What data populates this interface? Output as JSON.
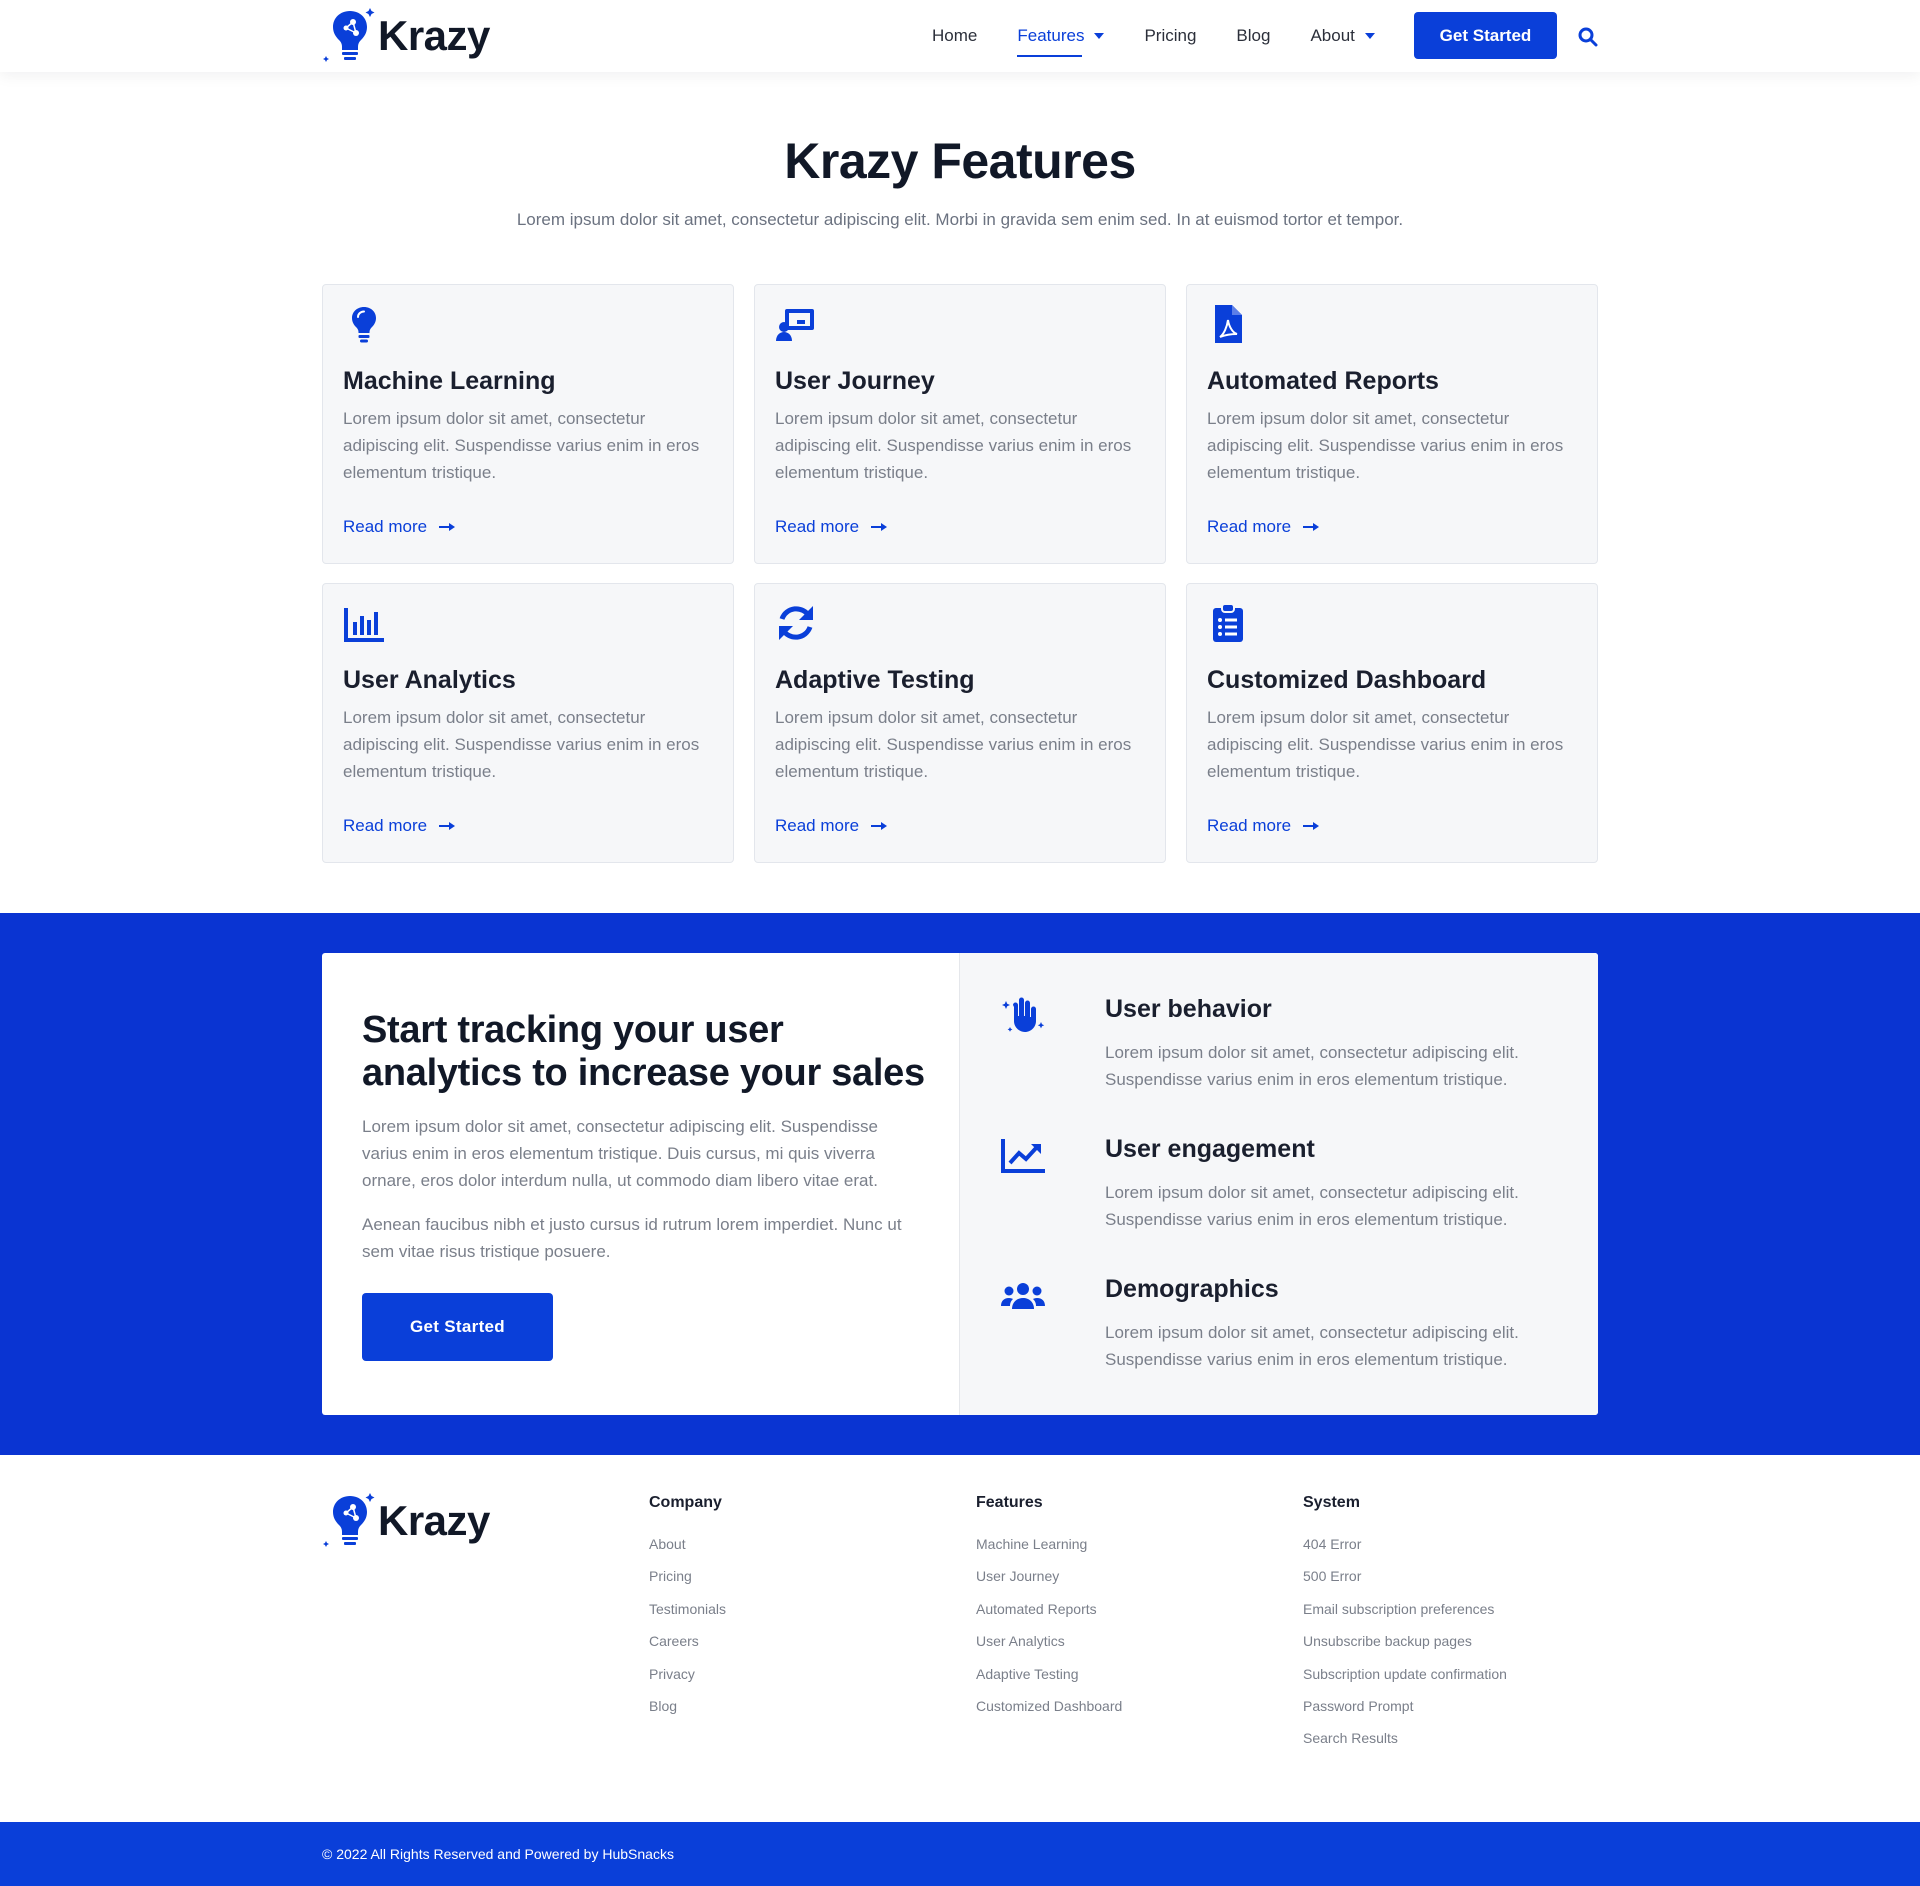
{
  "colors": {
    "brand": "#0a3fd9",
    "band": "#0a34d2",
    "card_bg": "#f6f7f9",
    "text_muted": "#7a7f8a"
  },
  "header": {
    "logo_text": "Krazy",
    "nav": [
      {
        "label": "Home"
      },
      {
        "label": "Features"
      },
      {
        "label": "Pricing"
      },
      {
        "label": "Blog"
      },
      {
        "label": "About"
      }
    ],
    "cta": "Get Started",
    "search_icon": "search-icon"
  },
  "hero": {
    "title": "Krazy Features",
    "subtitle": "Lorem ipsum dolor sit amet, consectetur adipiscing elit. Morbi in gravida sem enim sed. In at euismod tortor et tempor."
  },
  "features": [
    {
      "icon": "lightbulb-icon",
      "title": "Machine Learning",
      "text": "Lorem ipsum dolor sit amet, consectetur adipiscing elit. Suspendisse varius enim in eros elementum tristique.",
      "link": "Read more"
    },
    {
      "icon": "presentation-icon",
      "title": "User Journey",
      "text": "Lorem ipsum dolor sit amet, consectetur adipiscing elit. Suspendisse varius enim in eros elementum tristique.",
      "link": "Read more"
    },
    {
      "icon": "pdf-file-icon",
      "title": "Automated Reports",
      "text": "Lorem ipsum dolor sit amet, consectetur adipiscing elit. Suspendisse varius enim in eros elementum tristique.",
      "link": "Read more"
    },
    {
      "icon": "bar-chart-icon",
      "title": "User Analytics",
      "text": "Lorem ipsum dolor sit amet, consectetur adipiscing elit. Suspendisse varius enim in eros elementum tristique.",
      "link": "Read more"
    },
    {
      "icon": "sync-icon",
      "title": "Adaptive Testing",
      "text": "Lorem ipsum dolor sit amet, consectetur adipiscing elit. Suspendisse varius enim in eros elementum tristique.",
      "link": "Read more"
    },
    {
      "icon": "clipboard-list-icon",
      "title": "Customized Dashboard",
      "text": "Lorem ipsum dolor sit amet, consectetur adipiscing elit. Suspendisse varius enim in eros elementum tristique.",
      "link": "Read more"
    }
  ],
  "band": {
    "title": "Start tracking your user analytics to increase your sales",
    "p1": "Lorem ipsum dolor sit amet, consectetur adipiscing elit. Suspendisse varius enim in eros elementum tristique. Duis cursus, mi quis viverra ornare, eros dolor interdum nulla, ut commodo diam libero vitae erat.",
    "p2": "Aenean faucibus nibh et justo cursus id rutrum lorem imperdiet. Nunc ut sem vitae risus tristique posuere.",
    "cta": "Get Started",
    "benefits": [
      {
        "icon": "hand-sparkles-icon",
        "title": "User behavior",
        "text": "Lorem ipsum dolor sit amet, consectetur adipiscing elit. Suspendisse varius enim in eros elementum tristique."
      },
      {
        "icon": "trend-chart-icon",
        "title": "User engagement",
        "text": "Lorem ipsum dolor sit amet, consectetur adipiscing elit. Suspendisse varius enim in eros elementum tristique."
      },
      {
        "icon": "users-icon",
        "title": "Demographics",
        "text": "Lorem ipsum dolor sit amet, consectetur adipiscing elit. Suspendisse varius enim in eros elementum tristique."
      }
    ]
  },
  "footer": {
    "logo_text": "Krazy",
    "columns": [
      {
        "title": "Company",
        "links": [
          "About",
          "Pricing",
          "Testimonials",
          "Careers",
          "Privacy",
          "Blog"
        ]
      },
      {
        "title": "Features",
        "links": [
          "Machine Learning",
          "User Journey",
          "Automated Reports",
          "User Analytics",
          "Adaptive Testing",
          "Customized Dashboard"
        ]
      },
      {
        "title": "System",
        "links": [
          "404 Error",
          "500 Error",
          "Email subscription preferences",
          "Unsubscribe backup pages",
          "Subscription update confirmation",
          "Password Prompt",
          "Search Results"
        ]
      }
    ],
    "copyright": "© 2022 All Rights Reserved and Powered by HubSnacks"
  }
}
